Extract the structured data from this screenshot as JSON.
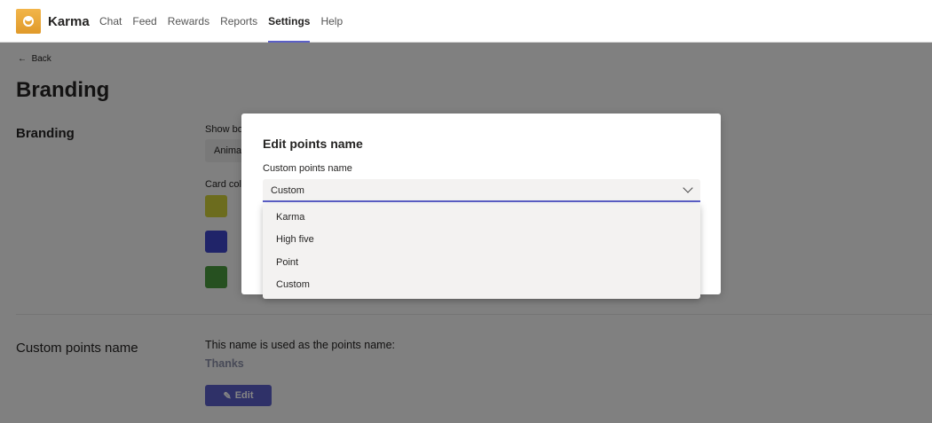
{
  "header": {
    "app_name": "Karma",
    "nav": [
      "Chat",
      "Feed",
      "Rewards",
      "Reports",
      "Settings",
      "Help"
    ],
    "active": "Settings"
  },
  "page": {
    "back": "Back",
    "title": "Branding",
    "branding": {
      "label": "Branding",
      "show_label": "Show bo",
      "select_value": "Anima",
      "card_colors_label": "Card col",
      "swatches": [
        "#cfcf3a",
        "#3f46c9",
        "#4a9a3e"
      ]
    },
    "points": {
      "label": "Custom points name",
      "description": "This name is used as the points name:",
      "value": "Thanks",
      "edit": "Edit"
    }
  },
  "modal": {
    "title": "Edit points name",
    "field_label": "Custom points name",
    "selected": "Custom",
    "options": [
      "Karma",
      "High five",
      "Point",
      "Custom"
    ]
  },
  "colors": {
    "accent": "#5b5fc7"
  }
}
